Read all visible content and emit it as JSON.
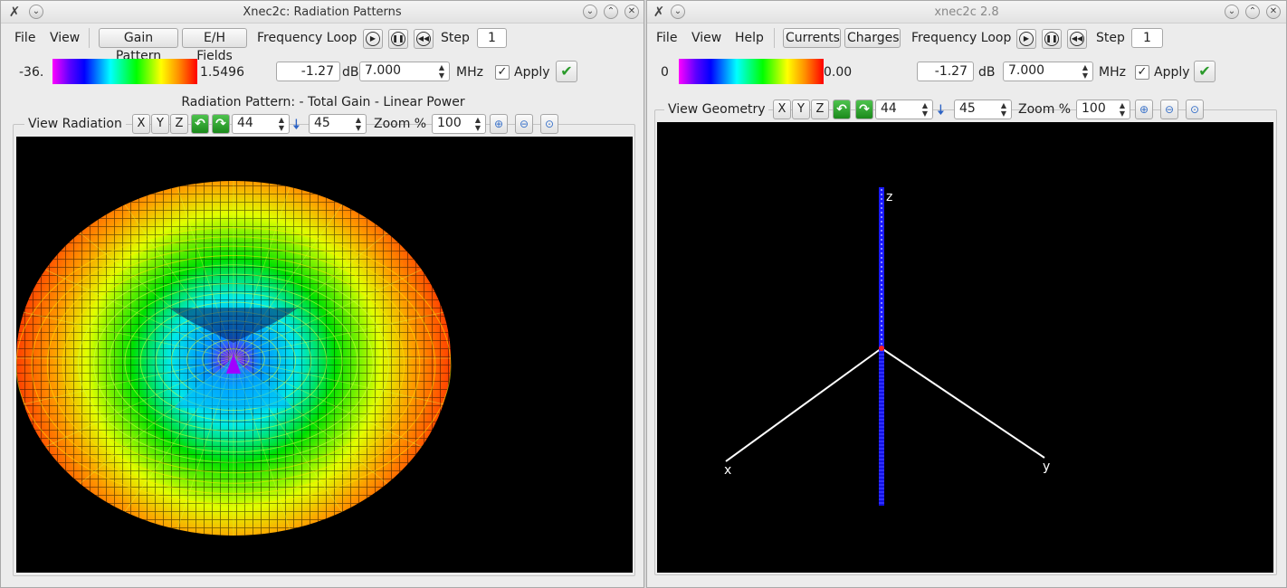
{
  "left": {
    "title": "Xnec2c: Radiation Patterns",
    "menu": {
      "file": "File",
      "view": "View"
    },
    "tabs": {
      "gain": "Gain Pattern",
      "eh": "E/H Fields"
    },
    "freq_loop": "Frequency Loop",
    "step_label": "Step",
    "step_value": "1",
    "scale_min": "-36.",
    "scale_max": "1.5496",
    "gain_value": "-1.27",
    "db_label": "dB",
    "freq_value": "7.000",
    "mhz_label": "MHz",
    "apply_label": "Apply",
    "heading": "Radiation Pattern: - Total Gain - Linear Power",
    "view_label": "View Radiation",
    "axis_buttons": [
      "X",
      "Y",
      "Z"
    ],
    "rot_value": "44",
    "incl_value": "45",
    "zoom_label": "Zoom %",
    "zoom_value": "100"
  },
  "right": {
    "title": "xnec2c 2.8",
    "menu": {
      "file": "File",
      "view": "View",
      "help": "Help"
    },
    "tabs": {
      "currents": "Currents",
      "charges": "Charges"
    },
    "freq_loop": "Frequency Loop",
    "step_label": "Step",
    "step_value": "1",
    "scale_min": "0",
    "scale_max": "0.00",
    "gain_value": "-1.27",
    "db_label": "dB",
    "freq_value": "7.000",
    "mhz_label": "MHz",
    "apply_label": "Apply",
    "view_label": "View Geometry",
    "axis_buttons": [
      "X",
      "Y",
      "Z"
    ],
    "rot_value": "44",
    "incl_value": "45",
    "zoom_label": "Zoom %",
    "zoom_value": "100",
    "axis_labels": {
      "x": "x",
      "y": "y",
      "z": "z"
    }
  }
}
